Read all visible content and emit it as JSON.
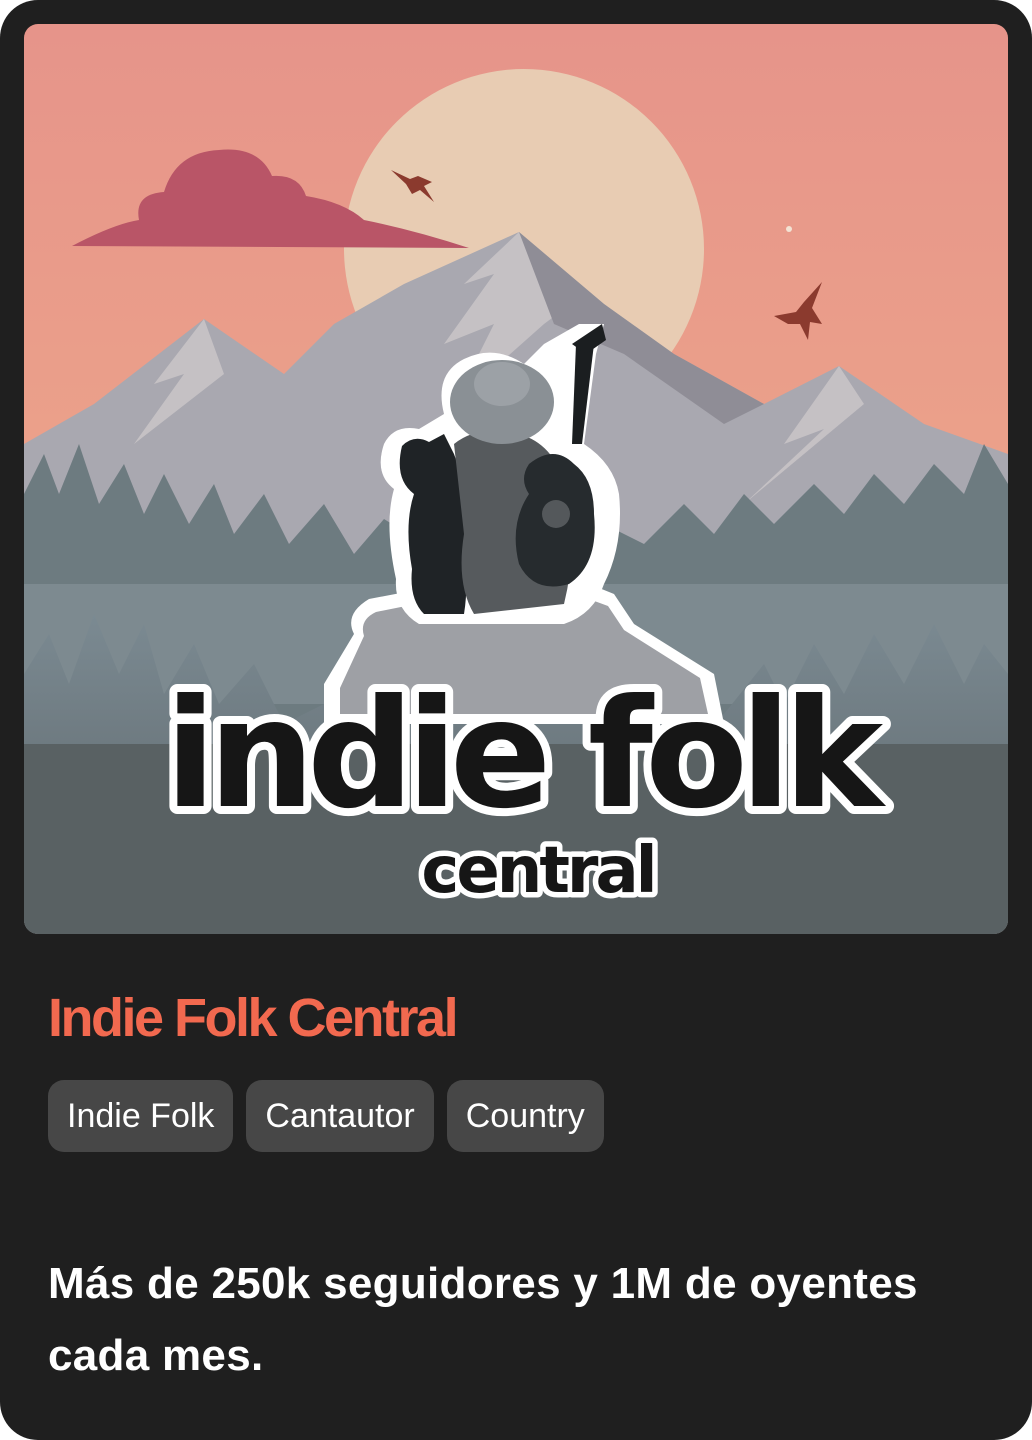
{
  "playlist": {
    "cover": {
      "logo_text_line1": "indie folk",
      "logo_text_line2": "central"
    },
    "title": "Indie Folk Central",
    "tags": [
      "Indie Folk",
      "Cantautor",
      "Country"
    ],
    "description": "Más de 250k seguidores y 1M de oyentes cada mes."
  },
  "colors": {
    "card_background": "#1f1f1f",
    "title_accent": "#f2694f",
    "tag_background": "#474747",
    "text": "#ffffff"
  }
}
